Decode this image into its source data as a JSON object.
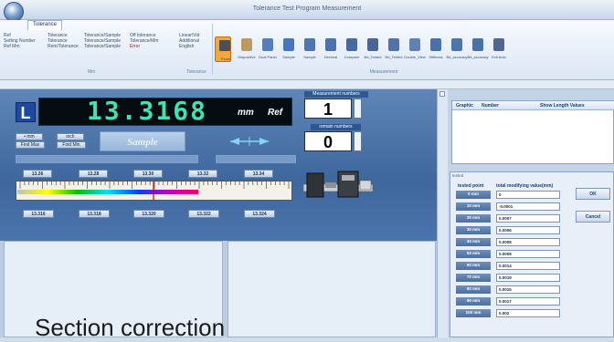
{
  "window": {
    "title": "Tolerance Test Program Measurement"
  },
  "ribbon": {
    "tab": "Tolerance",
    "group1_lines": [
      "Ref",
      "Setting Number",
      "Ref Mm"
    ],
    "group2_lines": [
      "Tolerance",
      "Tolerance",
      "Rem/Tolerance"
    ],
    "group3_lines": [
      "Tolerance/Sample",
      "Tolerance/Sample",
      "Tolerance/Sample"
    ],
    "group4_lines": [
      "Off tolerance",
      "Tolerance/Mm",
      "Error"
    ],
    "group5_lines": [
      "Linear/Vid",
      "Additional",
      "English"
    ],
    "group_label_1": "Mm",
    "group_label_2": "Tolerance",
    "group_label_3": "Measurement",
    "active_button": "Panel",
    "buttons": [
      "Panel",
      "Dispositive",
      "Dual Panel",
      "Sample",
      "Sample",
      "Decimal",
      "Compare",
      "Bd_Tested",
      "Bd_Tested",
      "Double_View",
      "Stiffness",
      "Bd_accuracy",
      "Bd_accuracy",
      "Exit Auto"
    ]
  },
  "readout": {
    "unit_letter": "L",
    "value": "13.3168",
    "unit": "mm",
    "ref": "Ref"
  },
  "controls": {
    "mm": "mm",
    "inch": "inch",
    "find_max": "Find Max",
    "find_min": "Find Min",
    "sample": "Sample"
  },
  "measurement": {
    "numbers_label": "Measurement numbers",
    "count": "1",
    "remain_label": "remain numbers",
    "remain": "0"
  },
  "scale": {
    "top_ticks": [
      "13.26",
      "13.28",
      "13.30",
      "13.32",
      "13.34"
    ],
    "bottom_ticks": [
      "13.316",
      "13.318",
      "13.320",
      "13.322",
      "13.324"
    ]
  },
  "graphic_table": {
    "headers": [
      "Graphic",
      "Number",
      "Show Length Values"
    ]
  },
  "correction": {
    "title": "tested",
    "col_point": "tested point",
    "col_value": "total modifying value(mm)",
    "rows": [
      {
        "point": "0 mm",
        "value": "0"
      },
      {
        "point": "10 mm",
        "value": "-0.0001"
      },
      {
        "point": "20 mm",
        "value": "0.0007"
      },
      {
        "point": "30 mm",
        "value": "0.0006"
      },
      {
        "point": "40 mm",
        "value": "0.0008"
      },
      {
        "point": "50 mm",
        "value": "0.0008"
      },
      {
        "point": "60 mm",
        "value": "0.0014"
      },
      {
        "point": "70 mm",
        "value": "0.0019"
      },
      {
        "point": "80 mm",
        "value": "0.0015"
      },
      {
        "point": "90 mm",
        "value": "0.0017"
      },
      {
        "point": "100 mm",
        "value": "0.002"
      }
    ],
    "ok": "OK",
    "cancel": "Cancel"
  },
  "caption": "Section correction"
}
